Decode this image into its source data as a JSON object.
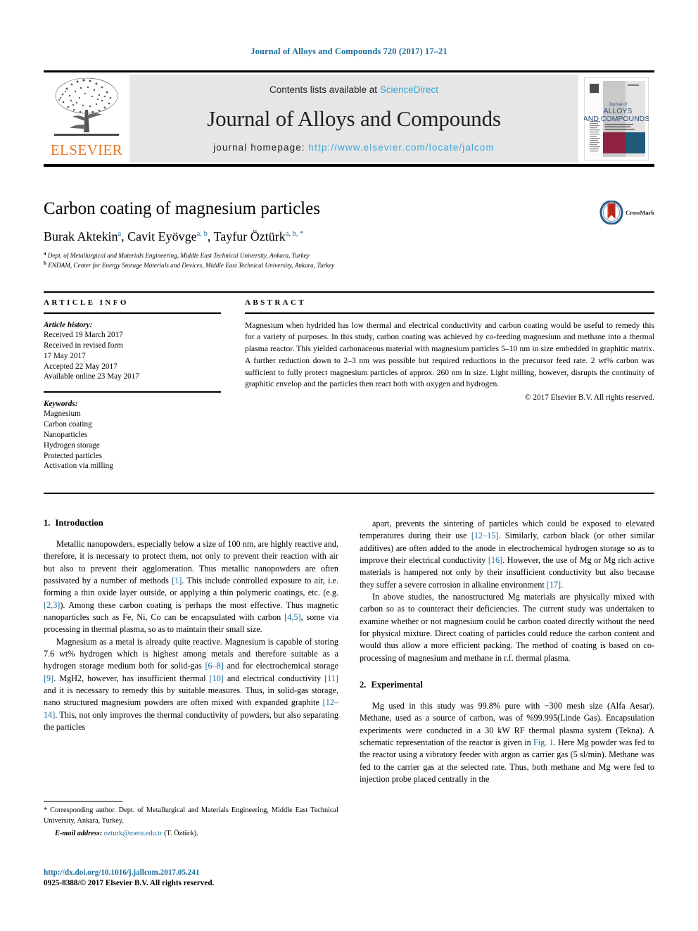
{
  "running_head": "Journal of Alloys and Compounds 720 (2017) 17–21",
  "masthead": {
    "contents_prefix": "Contents lists available at ",
    "sciencedirect": "ScienceDirect",
    "journal_title": "Journal of Alloys and Compounds",
    "homepage_prefix": "journal homepage: ",
    "homepage_url": "http://www.elsevier.com/locate/jalcom",
    "elsevier_wordmark": "ELSEVIER",
    "cover": {
      "line1": "Journal of",
      "line2": "ALLOYS",
      "line3": "AND COMPOUNDS"
    },
    "colors": {
      "link_blue": "#3ca5d8",
      "elsevier_orange": "#E87722",
      "grey_panel": "#e6e6e6",
      "cover_maroon": "#8f2241",
      "cover_teal": "#1f5b78",
      "cover_blue_text": "#2c4d7c"
    }
  },
  "article": {
    "title": "Carbon coating of magnesium particles",
    "authors": [
      {
        "name": "Burak Aktekin",
        "marks": "a"
      },
      {
        "name": "Cavit Eyövge",
        "marks": "a, b"
      },
      {
        "name": "Tayfur Öztürk",
        "marks": "a, b, *"
      }
    ],
    "affiliations": [
      {
        "mark": "a",
        "text": "Dept. of Metallurgical and Materials Engineering, Middle East Technical University, Ankara, Turkey"
      },
      {
        "mark": "b",
        "text": "ENDAM, Center for Energy Storage Materials and Devices, Middle East Technical University, Ankara, Turkey"
      }
    ],
    "crossmark_label": "CrossMark"
  },
  "info": {
    "heading": "ARTICLE INFO",
    "history_label": "Article history:",
    "history": [
      "Received 19 March 2017",
      "Received in revised form",
      "17 May 2017",
      "Accepted 22 May 2017",
      "Available online 23 May 2017"
    ],
    "keywords_label": "Keywords:",
    "keywords": [
      "Magnesium",
      "Carbon coating",
      "Nanoparticles",
      "Hydrogen storage",
      "Protected particles",
      "Activation via milling"
    ]
  },
  "abstract": {
    "heading": "ABSTRACT",
    "text": "Magnesium when hydrided has low thermal and electrical conductivity and carbon coating would be useful to remedy this for a variety of purposes. In this study, carbon coating was achieved by co-feeding magnesium and methane into a thermal plasma reactor. This yielded carbonaceous material with magnesium particles 5–10 nm in size embedded in graphitic matrix. A further reduction down to 2–3 nm was possible but required reductions in the precursor feed rate. 2 wt% carbon was sufficient to fully protect magnesium particles of approx. 260 nm in size. Light milling, however, disrupts the continuity of graphitic envelop and the particles then react both with oxygen and hydrogen.",
    "copyright": "© 2017 Elsevier B.V. All rights reserved."
  },
  "sections": {
    "intro_num": "1.",
    "intro_title": "Introduction",
    "exp_num": "2.",
    "exp_title": "Experimental"
  },
  "body": {
    "left": [
      "Metallic nanopowders, especially below a size of 100 nm, are highly reactive and, therefore, it is necessary to protect them, not only to prevent their reaction with air but also to prevent their agglomeration. Thus metallic nanopowders are often passivated by a number of methods [1]. This include controlled exposure to air, i.e. forming a thin oxide layer outside, or applying a thin polymeric coatings, etc. (e.g. [2,3]). Among these carbon coating is perhaps the most effective. Thus magnetic nanoparticles such as Fe, Ni, Co can be encapsulated with carbon [4,5], some via processing in thermal plasma, so as to maintain their small size.",
      "Magnesium as a metal is already quite reactive. Magnesium is capable of storing 7.6 wt% hydrogen which is highest among metals and therefore suitable as a hydrogen storage medium both for solid-gas [6–8] and for electrochemical storage [9]. MgH2, however, has insufficient thermal [10] and electrical conductivity [11] and it is necessary to remedy this by suitable measures. Thus, in solid-gas storage, nano structured magnesium powders are often mixed with expanded graphite [12–14]. This, not only improves the thermal conductivity of powders, but also separating the particles"
    ],
    "right": [
      "apart, prevents the sintering of particles which could be exposed to elevated temperatures during their use [12–15]. Similarly, carbon black (or other similar additives) are often added to the anode in electrochemical hydrogen storage so as to improve their electrical conductivity [16]. However, the use of Mg or Mg rich active materials is hampered not only by their insufficient conductivity but also because they suffer a severe corrosion in alkaline environment [17].",
      "In above studies, the nanostructured Mg materials are physically mixed with carbon so as to counteract their deficiencies. The current study was undertaken to examine whether or not magnesium could be carbon coated directly without the need for physical mixture. Direct coating of particles could reduce the carbon content and would thus allow a more efficient packing. The method of coating is based on co-processing of magnesium and methane in r.f. thermal plasma.",
      "Mg used in this study was 99.8% pure with −300 mesh size (Alfa Aesar). Methane, used as a source of carbon, was of %99.995(Linde Gas). Encapsulation experiments were conducted in a 30 kW RF thermal plasma system (Tekna). A schematic representation of the reactor is given in Fig. 1. Here Mg powder was fed to the reactor using a vibratory feeder with argon as carrier gas (5 sl/min). Methane was fed to the carrier gas at the selected rate. Thus, both methane and Mg were fed to injection probe placed centrally in the"
    ]
  },
  "footnotes": {
    "corresponding": "* Corresponding author. Dept. of Metallurgical and Materials Engineering, Middle East Technical University, Ankara, Turkey.",
    "email_label": "E-mail address:",
    "email": "ozturk@metu.edu.tr",
    "email_suffix": "(T. Öztürk)."
  },
  "doi": {
    "link": "http://dx.doi.org/10.1016/j.jallcom.2017.05.241",
    "issn_line": "0925-8388/© 2017 Elsevier B.V. All rights reserved."
  }
}
